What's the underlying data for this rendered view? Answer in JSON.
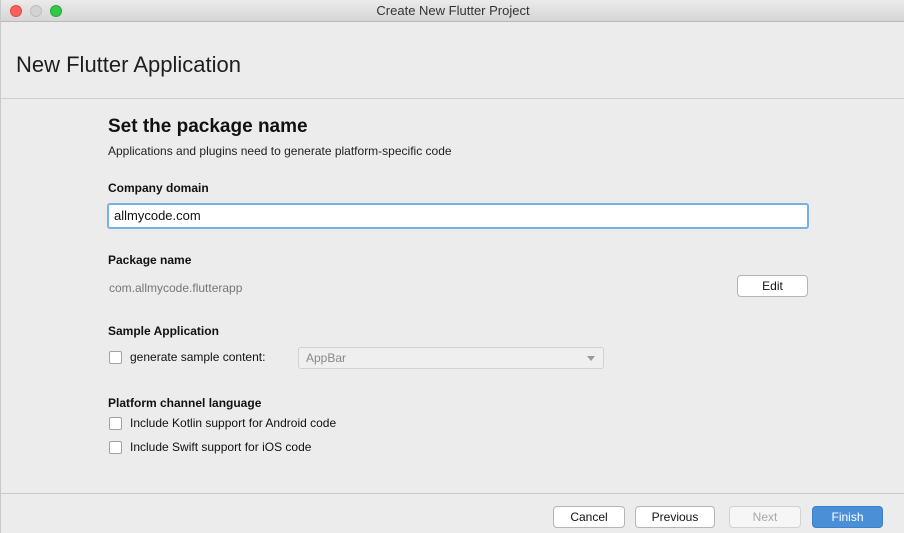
{
  "window": {
    "title": "Create New Flutter Project"
  },
  "header": {
    "title": "New Flutter Application"
  },
  "section": {
    "title": "Set the package name",
    "description": "Applications and plugins need to generate platform-specific code"
  },
  "company_domain": {
    "label": "Company domain",
    "value": "allmycode.com"
  },
  "package_name": {
    "label": "Package name",
    "value": "com.allmycode.flutterapp",
    "edit_label": "Edit"
  },
  "sample_application": {
    "label": "Sample Application",
    "checkbox_label": "generate sample content:",
    "checked": false,
    "selected_sample": "AppBar"
  },
  "platform_channel": {
    "label": "Platform channel language",
    "kotlin_label": "Include Kotlin support for Android code",
    "kotlin_checked": false,
    "swift_label": "Include Swift support for iOS code",
    "swift_checked": false
  },
  "footer": {
    "cancel_label": "Cancel",
    "previous_label": "Previous",
    "next_label": "Next",
    "finish_label": "Finish"
  },
  "colors": {
    "accent": "#4a90d9",
    "focus_ring": "#7aaee8",
    "window_bg": "#ececec",
    "close": "#fc605b",
    "maximize": "#34c84a"
  }
}
